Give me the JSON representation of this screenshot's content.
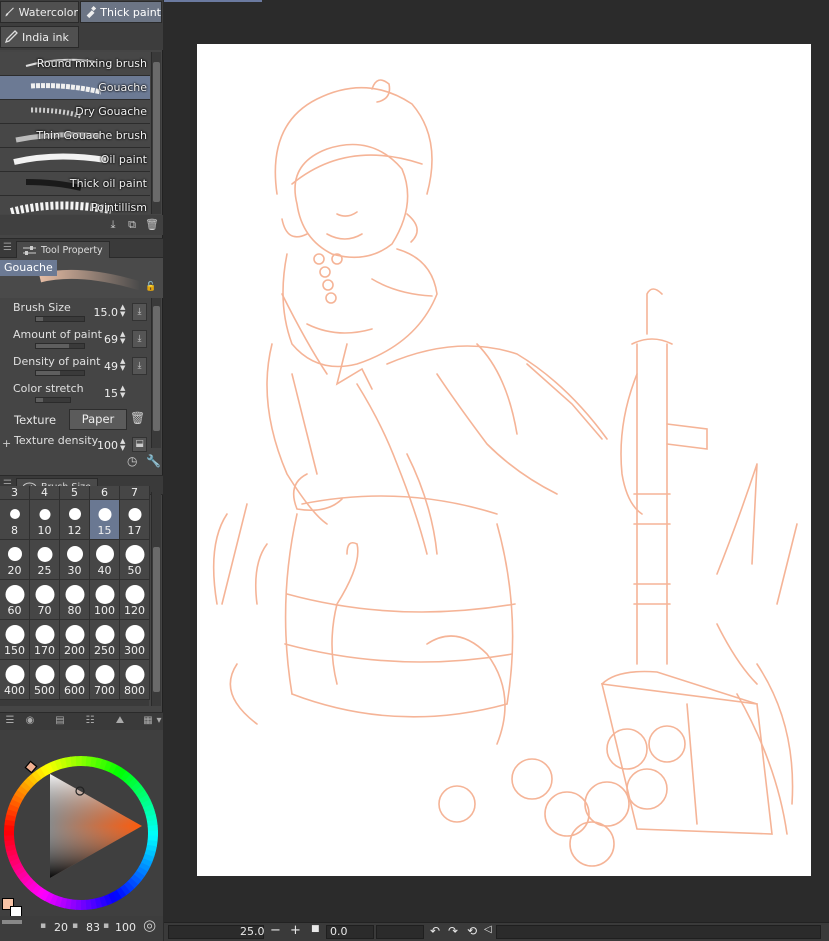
{
  "subtool_tabs": [
    {
      "label": "Watercolor",
      "icon": "brush-icon",
      "active": false
    },
    {
      "label": "Thick paint",
      "icon": "paint-tube-icon",
      "active": true
    },
    {
      "label": "India ink",
      "icon": "pen-nib-icon",
      "active": false
    }
  ],
  "brushes": [
    {
      "label": "Round mixing brush",
      "selected": false
    },
    {
      "label": "Gouache",
      "selected": true
    },
    {
      "label": "Dry Gouache",
      "selected": false
    },
    {
      "label": "Thin Gouache brush",
      "selected": false
    },
    {
      "label": "Oil paint",
      "selected": false
    },
    {
      "label": "Thick oil paint",
      "selected": false
    },
    {
      "label": "Pointillism",
      "selected": false
    }
  ],
  "tool_property": {
    "tab_label": "Tool Property",
    "brush_name": "Gouache",
    "properties": [
      {
        "label": "Brush Size",
        "value": "15.0",
        "level": 0.15
      },
      {
        "label": "Amount of paint",
        "value": "69",
        "level": 0.69
      },
      {
        "label": "Density of paint",
        "value": "49",
        "level": 0.49
      },
      {
        "label": "Color stretch",
        "value": "15",
        "level": 0.15
      }
    ],
    "texture_label": "Texture",
    "texture_value": "Paper",
    "texture_density_label": "Texture density",
    "texture_density_value": "100"
  },
  "brush_size_panel": {
    "tab_label": "Brush Size",
    "top_row": [
      "3",
      "4",
      "5",
      "6",
      "7"
    ],
    "sizes": [
      "8",
      "10",
      "12",
      "15",
      "17",
      "20",
      "25",
      "30",
      "40",
      "50",
      "60",
      "70",
      "80",
      "100",
      "120",
      "150",
      "170",
      "200",
      "250",
      "300",
      "400",
      "500",
      "600",
      "700",
      "800"
    ],
    "selected": "15"
  },
  "color": {
    "main": "#e46a2e",
    "sub": "#ffffff",
    "swatch": "#f7c3a6"
  },
  "left_status": {
    "a": "20",
    "b": "83",
    "c": "100"
  },
  "canvas_status": {
    "zoom": "25.0",
    "angle": "0.0"
  },
  "sketch_color": "#f5b497"
}
